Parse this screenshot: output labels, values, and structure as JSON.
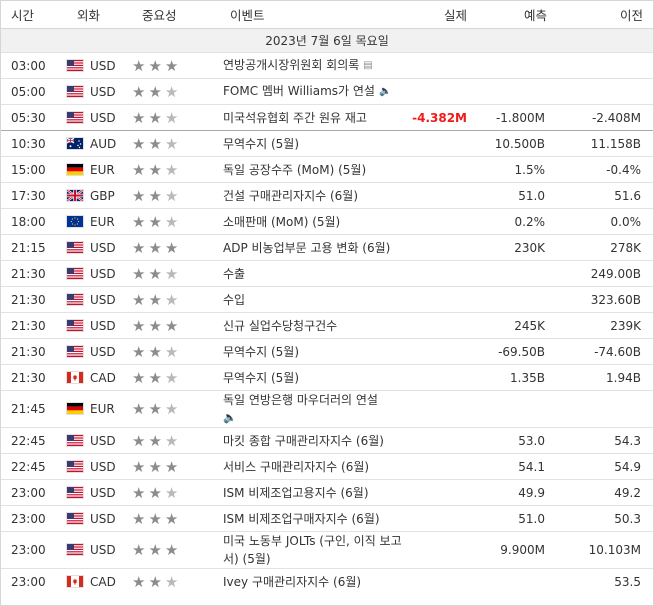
{
  "headers": {
    "time": "시간",
    "currency": "외화",
    "importance": "중요성",
    "event": "이벤트",
    "actual": "실제",
    "forecast": "예측",
    "previous": "이전"
  },
  "date_label": "2023년 7월 6일 목요일",
  "rows": [
    {
      "time": "03:00",
      "flag": "us",
      "currency": "USD",
      "stars": 3,
      "event": "연방공개시장위원회 회의록",
      "event_icon": "document-icon",
      "actual": "",
      "forecast": "",
      "previous": ""
    },
    {
      "time": "05:00",
      "flag": "us",
      "currency": "USD",
      "stars": 2,
      "event": "FOMC 멤버 Williams가 연설",
      "event_icon": "speaker-icon",
      "actual": "",
      "forecast": "",
      "previous": ""
    },
    {
      "time": "05:30",
      "flag": "us",
      "currency": "USD",
      "stars": 2,
      "event": "미국석유협회 주간 원유 재고",
      "actual": "-4.382M",
      "actual_color": "#ef1b1b",
      "forecast": "-1.800M",
      "previous": "-2.408M"
    },
    {
      "time": "10:30",
      "flag": "au",
      "currency": "AUD",
      "stars": 2,
      "event": "무역수지 (5월)",
      "actual": "",
      "forecast": "10.500B",
      "previous": "11.158B",
      "sep": true
    },
    {
      "time": "15:00",
      "flag": "de",
      "currency": "EUR",
      "stars": 2,
      "event": "독일 공장수주 (MoM) (5월)",
      "actual": "",
      "forecast": "1.5%",
      "previous": "-0.4%"
    },
    {
      "time": "17:30",
      "flag": "gb",
      "currency": "GBP",
      "stars": 2,
      "event": "건설 구매관리자지수 (6월)",
      "actual": "",
      "forecast": "51.0",
      "previous": "51.6"
    },
    {
      "time": "18:00",
      "flag": "eu",
      "currency": "EUR",
      "stars": 2,
      "event": "소매판매 (MoM) (5월)",
      "actual": "",
      "forecast": "0.2%",
      "previous": "0.0%"
    },
    {
      "time": "21:15",
      "flag": "us",
      "currency": "USD",
      "stars": 3,
      "event": "ADP 비농업부문 고용 변화 (6월)",
      "actual": "",
      "forecast": "230K",
      "previous": "278K"
    },
    {
      "time": "21:30",
      "flag": "us",
      "currency": "USD",
      "stars": 2,
      "event": "수출",
      "actual": "",
      "forecast": "",
      "previous": "249.00B"
    },
    {
      "time": "21:30",
      "flag": "us",
      "currency": "USD",
      "stars": 2,
      "event": "수입",
      "actual": "",
      "forecast": "",
      "previous": "323.60B"
    },
    {
      "time": "21:30",
      "flag": "us",
      "currency": "USD",
      "stars": 3,
      "event": "신규 실업수당청구건수",
      "actual": "",
      "forecast": "245K",
      "previous": "239K"
    },
    {
      "time": "21:30",
      "flag": "us",
      "currency": "USD",
      "stars": 2,
      "event": "무역수지 (5월)",
      "actual": "",
      "forecast": "-69.50B",
      "previous": "-74.60B"
    },
    {
      "time": "21:30",
      "flag": "ca",
      "currency": "CAD",
      "stars": 2,
      "event": "무역수지 (5월)",
      "actual": "",
      "forecast": "1.35B",
      "previous": "1.94B"
    },
    {
      "time": "21:45",
      "flag": "de",
      "currency": "EUR",
      "stars": 2,
      "event": "독일 연방은행 마우더러의 연설",
      "event_icon": "speaker-icon",
      "actual": "",
      "forecast": "",
      "previous": "",
      "tall": true
    },
    {
      "time": "22:45",
      "flag": "us",
      "currency": "USD",
      "stars": 2,
      "event": "마킷 종합 구매관리자지수 (6월)",
      "actual": "",
      "forecast": "53.0",
      "previous": "54.3"
    },
    {
      "time": "22:45",
      "flag": "us",
      "currency": "USD",
      "stars": 3,
      "event": "서비스 구매관리자지수 (6월)",
      "actual": "",
      "forecast": "54.1",
      "previous": "54.9"
    },
    {
      "time": "23:00",
      "flag": "us",
      "currency": "USD",
      "stars": 2,
      "event": "ISM 비제조업고용지수 (6월)",
      "actual": "",
      "forecast": "49.9",
      "previous": "49.2"
    },
    {
      "time": "23:00",
      "flag": "us",
      "currency": "USD",
      "stars": 3,
      "event": "ISM 비제조업구매자지수 (6월)",
      "actual": "",
      "forecast": "51.0",
      "previous": "50.3"
    },
    {
      "time": "23:00",
      "flag": "us",
      "currency": "USD",
      "stars": 3,
      "event": "미국 노동부 JOLTs (구인, 이직 보고서) (5월)",
      "actual": "",
      "forecast": "9.900M",
      "previous": "10.103M",
      "tall": true
    },
    {
      "time": "23:00",
      "flag": "ca",
      "currency": "CAD",
      "stars": 2,
      "event": "Ivey 구매관리자지수 (6월)",
      "actual": "",
      "forecast": "",
      "previous": "53.5"
    }
  ]
}
